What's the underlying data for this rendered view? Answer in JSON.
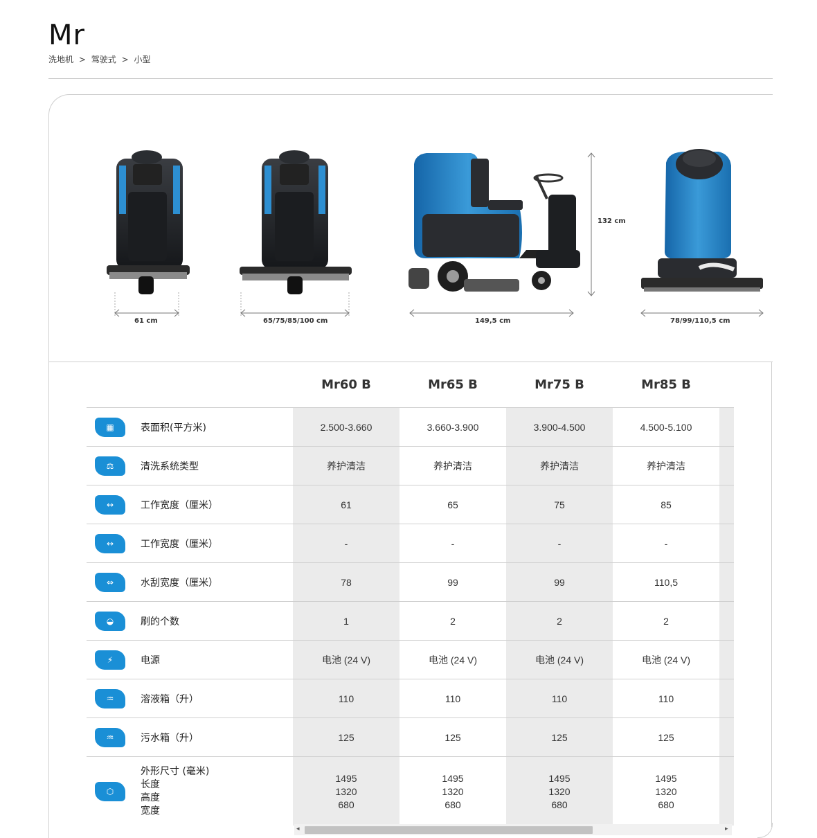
{
  "header": {
    "title": "Mr",
    "breadcrumb": [
      "洗地机",
      ">",
      "驾驶式",
      ">",
      "小型"
    ]
  },
  "images": {
    "dims": {
      "front_width": "61 cm",
      "front_deck": "65/75/85/100 cm",
      "side_length": "149,5 cm",
      "height": "132 cm",
      "rear_squeegee": "78/99/110,5 cm"
    }
  },
  "table": {
    "models": [
      "Mr60 B",
      "Mr65 B",
      "Mr75 B",
      "Mr85 B"
    ],
    "rows": [
      {
        "icon": "surface-area-icon",
        "glyph": "▦",
        "label": "表面积(平方米)",
        "values": [
          "2.500-3.660",
          "3.660-3.900",
          "3.900-4.500",
          "4.500-5.100"
        ]
      },
      {
        "icon": "cleaning-system-icon",
        "glyph": "⚖",
        "label": "清洗系统类型",
        "values": [
          "养护清洁",
          "养护清洁",
          "养护清洁",
          "养护清洁"
        ]
      },
      {
        "icon": "brush-width-icon",
        "glyph": "↔",
        "label": "工作宽度（厘米）",
        "values": [
          "61",
          "65",
          "75",
          "85"
        ]
      },
      {
        "icon": "brush-width-alt-icon",
        "glyph": "↔",
        "label": "工作宽度（厘米）",
        "values": [
          "-",
          "-",
          "-",
          "-"
        ]
      },
      {
        "icon": "squeegee-width-icon",
        "glyph": "⇔",
        "label": "水刮宽度（厘米）",
        "values": [
          "78",
          "99",
          "99",
          "110,5"
        ]
      },
      {
        "icon": "brush-count-icon",
        "glyph": "◒",
        "label": "刷的个数",
        "values": [
          "1",
          "2",
          "2",
          "2"
        ]
      },
      {
        "icon": "power-source-icon",
        "glyph": "⚡",
        "label": "电源",
        "values": [
          "电池 (24 V)",
          "电池 (24 V)",
          "电池 (24 V)",
          "电池 (24 V)"
        ]
      },
      {
        "icon": "solution-tank-icon",
        "glyph": "♒",
        "label": "溶液箱（升）",
        "values": [
          "110",
          "110",
          "110",
          "110"
        ]
      },
      {
        "icon": "recovery-tank-icon",
        "glyph": "♒",
        "label": "污水箱（升）",
        "values": [
          "125",
          "125",
          "125",
          "125"
        ]
      }
    ],
    "dimensions_row": {
      "icon": "dimensions-box-icon",
      "glyph": "⬡",
      "label_lines": [
        "外形尺寸 (毫米)",
        "长度",
        "高度",
        "宽度"
      ],
      "values": [
        [
          "1495",
          "1320",
          "680"
        ],
        [
          "1495",
          "1320",
          "680"
        ],
        [
          "1495",
          "1320",
          "680"
        ],
        [
          "1495",
          "1320",
          "680"
        ]
      ]
    }
  },
  "scrollbar": {
    "left_arrow": "◂",
    "right_arrow": "▸"
  }
}
